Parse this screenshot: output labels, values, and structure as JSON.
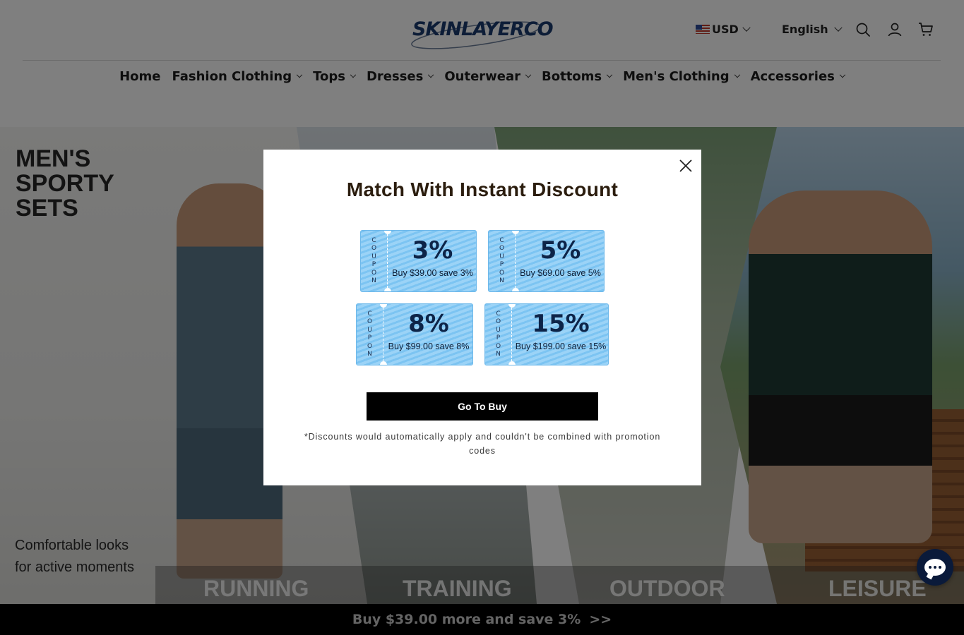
{
  "header": {
    "logo_text": "SKINLAYERCO",
    "currency": "USD",
    "language": "English",
    "icons": [
      "search-icon",
      "account-icon",
      "cart-icon"
    ]
  },
  "nav": {
    "items": [
      {
        "label": "Home",
        "dropdown": false
      },
      {
        "label": "Fashion Clothing",
        "dropdown": true
      },
      {
        "label": "Tops",
        "dropdown": true
      },
      {
        "label": "Dresses",
        "dropdown": true
      },
      {
        "label": "Outerwear",
        "dropdown": true
      },
      {
        "label": "Bottoms",
        "dropdown": true
      },
      {
        "label": "Men's Clothing",
        "dropdown": true
      },
      {
        "label": "Accessories",
        "dropdown": true
      }
    ]
  },
  "hero": {
    "title_lines": [
      "MEN'S",
      "SPORTY",
      "SETS"
    ],
    "subtitle_lines": [
      "Comfortable looks",
      "for active moments"
    ],
    "categories": [
      "RUNNING",
      "TRAINING",
      "OUTDOOR",
      "LEISURE"
    ]
  },
  "modal": {
    "title": "Match With Instant Discount",
    "coupon_stub_text": "COUPON",
    "coupons": [
      {
        "percent": "3%",
        "desc": "Buy $39.00 save 3%"
      },
      {
        "percent": "5%",
        "desc": "Buy $69.00 save 5%"
      },
      {
        "percent": "8%",
        "desc": "Buy $99.00 save 8%"
      },
      {
        "percent": "15%",
        "desc": "Buy $199.00 save 15%"
      }
    ],
    "button_label": "Go To Buy",
    "note": "*Discounts would automatically apply and couldn't be combined with promotion codes"
  },
  "bottom_bar": {
    "text": "Buy $39.00 more and save 3%",
    "arrow": ">>"
  },
  "colors": {
    "overlay": "rgba(0,0,0,0.5)",
    "coupon_blue": "#8ecdf5",
    "button_black": "#000000",
    "chat_navy": "#0a1a3a"
  }
}
